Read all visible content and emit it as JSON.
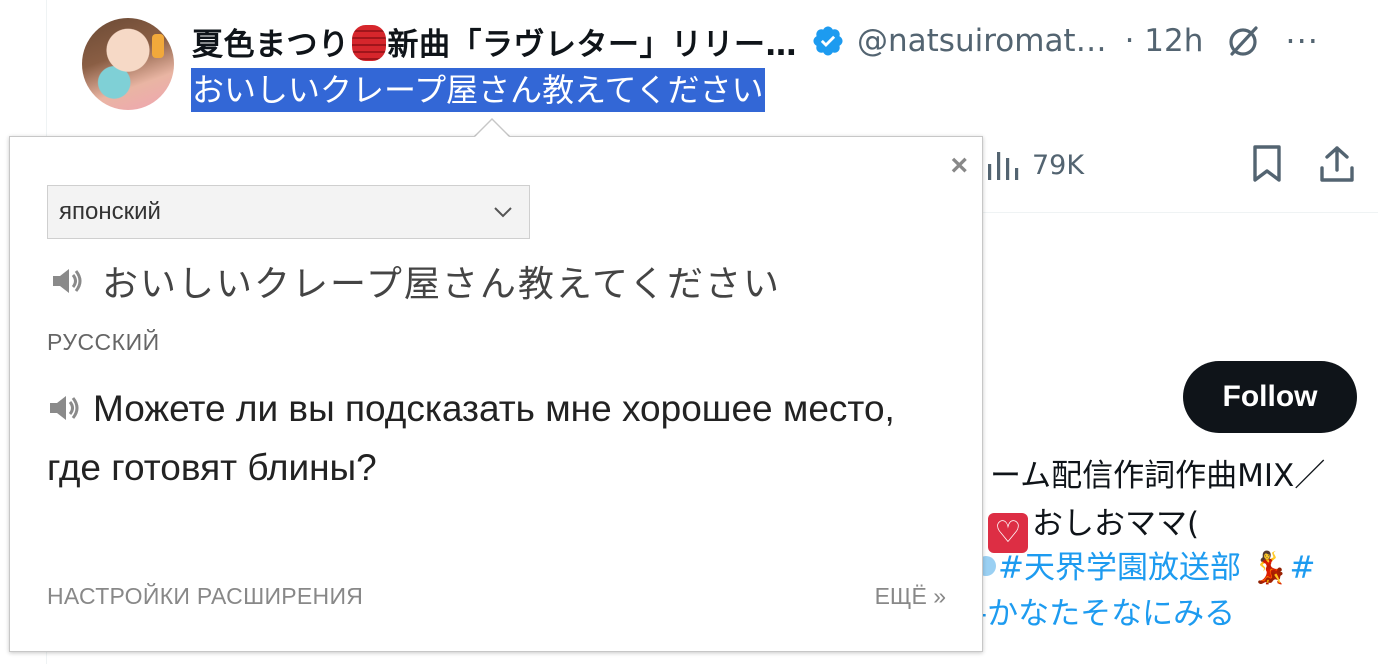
{
  "tweet": {
    "author_part1": "夏色まつり",
    "author_emoji": "lantern-icon",
    "author_part2": "新曲「ラヴレター」リリー…",
    "handle": "@natsuiromat…",
    "time": "· 12h",
    "text": "おいしいクレープ屋さん教えてください",
    "more": "···",
    "views": "79K"
  },
  "profile": {
    "follow_label": "Follow",
    "bio_line1": "ーム配信作詞作曲MIX／",
    "bio_line2": "おしおママ(",
    "bio_line3": "#天界学園放送部",
    "bio_line3_tail": "#",
    "bio_line4": "-かなたそなにみる"
  },
  "popup": {
    "close": "×",
    "source_lang": "японский",
    "source_text": "おいしいクレープ屋さん教えてください",
    "target_lang": "РУССКИЙ",
    "translation": "Можете ли вы подсказать мне хорошее место, где готовят блины?",
    "settings_link": "НАСТРОЙКИ РАСШИРЕНИЯ",
    "more_link": "ЕЩЁ »"
  },
  "colors": {
    "selection": "#3367d6",
    "link": "#1d9bf0",
    "verified": "#1d9bf0",
    "follow_bg": "#0f1419"
  }
}
